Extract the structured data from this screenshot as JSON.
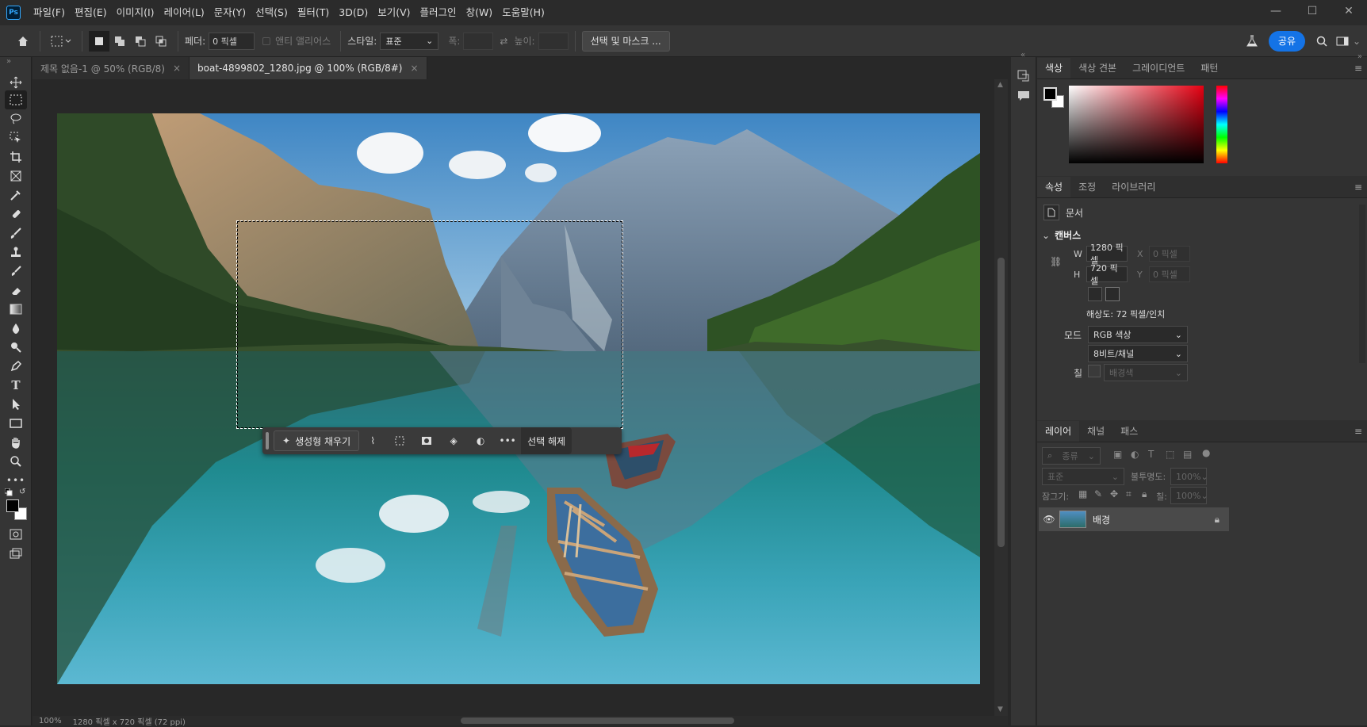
{
  "menubar": {
    "logo": "Ps",
    "items": [
      "파일(F)",
      "편집(E)",
      "이미지(I)",
      "레이어(L)",
      "문자(Y)",
      "선택(S)",
      "필터(T)",
      "3D(D)",
      "보기(V)",
      "플러그인",
      "창(W)",
      "도움말(H)"
    ]
  },
  "options": {
    "feather_label": "페더:",
    "feather_value": "0 픽셀",
    "antialias_label": "앤티 앨리어스",
    "style_label": "스타일:",
    "style_value": "표준",
    "width_label": "폭:",
    "height_label": "높이:",
    "select_mask_label": "선택 및 마스크 ...",
    "share_label": "공유"
  },
  "tabs": [
    {
      "label": "제목 없음-1 @ 50% (RGB/8)"
    },
    {
      "label": "boat-4899802_1280.jpg @ 100% (RGB/8#)"
    }
  ],
  "status": {
    "zoom": "100%",
    "doc_info": "1280 픽셀 x 720 픽셀 (72 ppi)"
  },
  "context_bar": {
    "generative_fill": "생성형 채우기",
    "deselect": "선택 해제"
  },
  "color_panel": {
    "tabs": [
      "색상",
      "색상 견본",
      "그레이디언트",
      "패턴"
    ]
  },
  "properties_panel": {
    "tabs": [
      "속성",
      "조정",
      "라이브러리"
    ],
    "doc_label": "문서",
    "canvas_header": "캔버스",
    "w_label": "W",
    "w_value": "1280 픽셀",
    "h_label": "H",
    "h_value": "720 픽셀",
    "x_label": "X",
    "x_placeholder": "0 픽셀",
    "y_label": "Y",
    "y_placeholder": "0 픽셀",
    "resolution": "해상도: 72 픽셀/인치",
    "mode_label": "모드",
    "mode_value": "RGB 색상",
    "depth_value": "8비트/채널",
    "fill_label": "칠",
    "fill_value": "배경색"
  },
  "layers_panel": {
    "tabs": [
      "레이어",
      "채널",
      "패스"
    ],
    "kind_filter": "종류",
    "blend_mode": "표준",
    "opacity_label": "불투명도:",
    "opacity_value": "100%",
    "lock_label": "잠그기:",
    "fill_label": "칠:",
    "fill_value": "100%",
    "layer_name": "배경"
  },
  "colors": {
    "accent": "#1473e6",
    "bg": "#282828",
    "panel": "#353535"
  }
}
